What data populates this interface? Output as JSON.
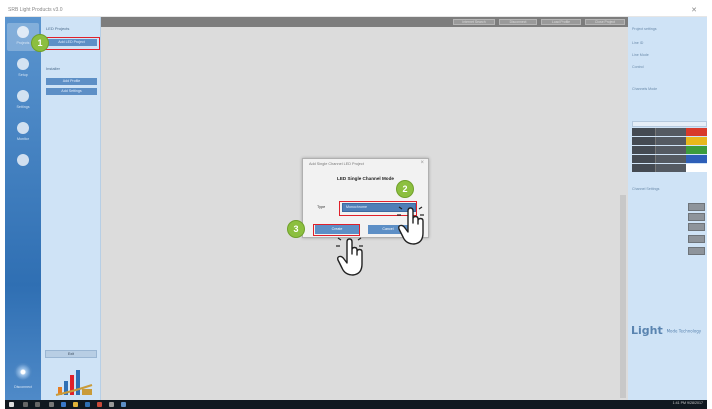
{
  "window": {
    "title": "SRB Light Products v3.0",
    "close_icon": "close-icon"
  },
  "toolbar": {
    "buttons": [
      "Internet Search",
      "Disconnect",
      "Load Profile",
      "Close Project"
    ]
  },
  "rail": {
    "items": [
      {
        "label": "Projects",
        "icon": "folder-icon"
      },
      {
        "label": "Setup",
        "icon": "gear-icon"
      },
      {
        "label": "Settings",
        "icon": "sliders-icon"
      },
      {
        "label": "Monitor",
        "icon": "monitor-icon"
      }
    ],
    "disc_label": "Disconnect"
  },
  "panel2": {
    "heading1": "LED Projects",
    "button1": "Add LED Project",
    "heading2": "Installer",
    "button2": "Add Profile",
    "button3": "Add Settings",
    "bottom_button": "Exit"
  },
  "right_panel": {
    "lines": [
      "Project settings",
      "Line ID",
      "Line Mode",
      "Control"
    ],
    "section_label": "Channels Mode",
    "table_header": "Ch",
    "swatches": [
      "#d83a2a",
      "#e8b81c",
      "#3c9c3c",
      "#2e5fb8",
      "#ffffff"
    ],
    "section2_label": "Channel Settings",
    "brand": "Light",
    "brand_sub": "Mode Technology"
  },
  "dialog": {
    "title": "Add Single Channel LED Project",
    "heading": "LED Single Channel Mode",
    "label": "Type",
    "select_value": "Monochrome",
    "ok_label": "Create",
    "cancel_label": "Cancel"
  },
  "steps": [
    "1",
    "2",
    "3"
  ],
  "taskbar": {
    "clock": "1:41 PM 9/28/2017"
  },
  "colors": {
    "accent": "#5d8fc6",
    "highlight": "#e0202a",
    "step_badge": "#8cbf3f",
    "canvas": "#dcdcdc"
  }
}
